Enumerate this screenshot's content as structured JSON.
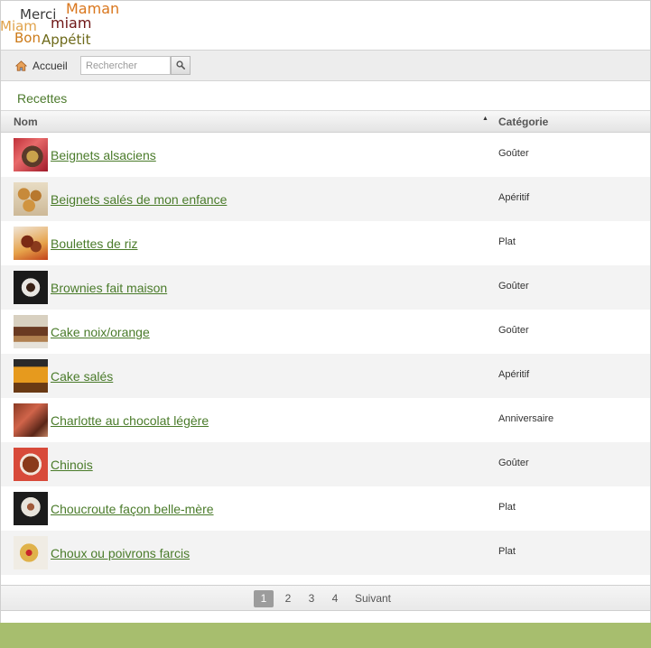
{
  "logo": {
    "words": {
      "merci": "Merci",
      "maman": "Maman",
      "miam1": "Miam",
      "miam2": "miam",
      "bon": "Bon",
      "appetit": "Appétit"
    }
  },
  "toolbar": {
    "home_label": "Accueil",
    "home_icon": "home-icon",
    "search_placeholder": "Rechercher",
    "search_value": "",
    "search_icon": "search-icon"
  },
  "section": {
    "title": "Recettes"
  },
  "table": {
    "columns": {
      "name": "Nom",
      "category": "Catégorie"
    },
    "sort": {
      "column": "Nom",
      "direction": "ascending",
      "icon": "▲"
    },
    "rows": [
      {
        "name": "Beignets alsaciens",
        "category": "Goûter"
      },
      {
        "name": "Beignets salés de mon enfance",
        "category": "Apéritif"
      },
      {
        "name": "Boulettes de riz",
        "category": "Plat"
      },
      {
        "name": "Brownies fait maison",
        "category": "Goûter"
      },
      {
        "name": "Cake noix/orange",
        "category": "Goûter"
      },
      {
        "name": "Cake salés",
        "category": "Apéritif"
      },
      {
        "name": "Charlotte au chocolat légère",
        "category": "Anniversaire"
      },
      {
        "name": "Chinois",
        "category": "Goûter"
      },
      {
        "name": "Choucroute façon belle-mère",
        "category": "Plat"
      },
      {
        "name": "Choux ou poivrons farcis",
        "category": "Plat"
      }
    ]
  },
  "pagination": {
    "current": "1",
    "pages": [
      "1",
      "2",
      "3",
      "4"
    ],
    "next_label": "Suivant"
  },
  "colors": {
    "accent_green": "#4a7b2a",
    "footer_green": "#a7be6e",
    "row_alt": "#f3f3f3"
  }
}
